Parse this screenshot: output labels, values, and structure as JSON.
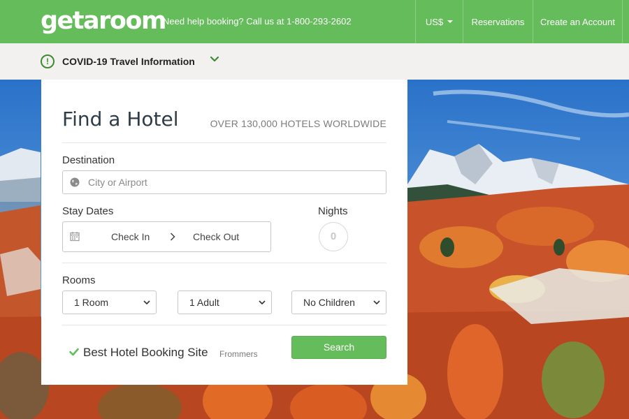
{
  "header": {
    "logo": "getaroom",
    "help_text": "Need help booking? Call us at 1-800-293-2602",
    "currency": "US$",
    "reservations": "Reservations",
    "create_account": "Create an Account",
    "bg_color": "#64bc5a"
  },
  "covid_bar": {
    "alert_glyph": "!",
    "label": "COVID-19 Travel Information",
    "icon": "chevron-down-icon"
  },
  "search": {
    "title": "Find a Hotel",
    "subtitle": "OVER 130,000 HOTELS WORLDWIDE",
    "destination_label": "Destination",
    "destination_placeholder": "City or Airport",
    "destination_value": "",
    "stay_dates_label": "Stay Dates",
    "check_in": "Check In",
    "check_out": "Check Out",
    "nights_label": "Nights",
    "nights_value": "0",
    "rooms_label": "Rooms",
    "rooms_value": "1 Room",
    "adults_value": "1 Adult",
    "children_value": "No Children",
    "best_text": "Best Hotel Booking Site",
    "best_source": "Frommers",
    "search_button": "Search"
  },
  "hero": {
    "description_icon": "mountain-landscape-image"
  }
}
